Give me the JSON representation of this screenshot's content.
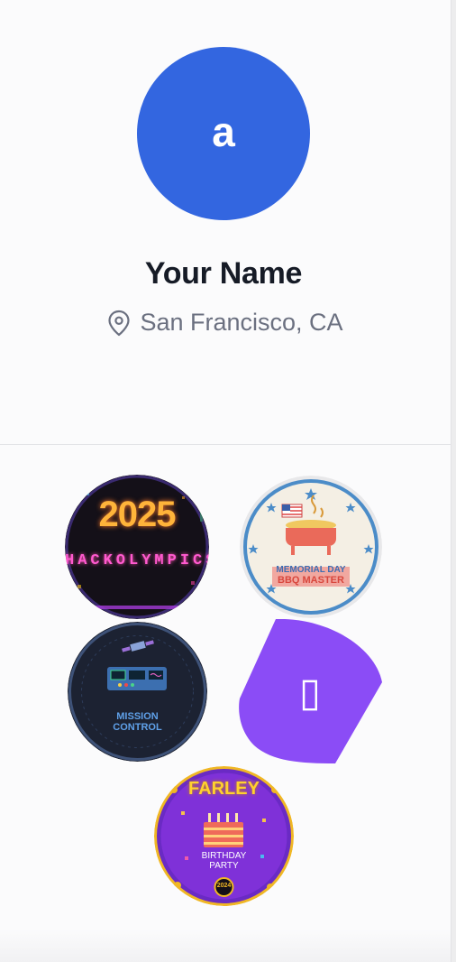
{
  "profile": {
    "avatar_initial": "a",
    "avatar_color": "#3366e0",
    "name": "Your Name",
    "location": "San Francisco, CA",
    "location_icon": "map-pin-icon"
  },
  "badges": [
    {
      "id": "hackolympics",
      "year": "2025",
      "title": "HACKOLYMPICS"
    },
    {
      "id": "memorial-day",
      "title_line1": "MEMORIAL DAY",
      "title_line2": "BBQ MASTER"
    },
    {
      "id": "mission-control",
      "title_line1": "MISSION",
      "title_line2": "CONTROL"
    },
    {
      "id": "purple-placeholder",
      "glyph": "▯",
      "color": "#8b4cf6"
    },
    {
      "id": "farley-birthday",
      "top": "FARLEY",
      "line1": "BIRTHDAY",
      "line2": "PARTY",
      "year": "2024"
    }
  ]
}
